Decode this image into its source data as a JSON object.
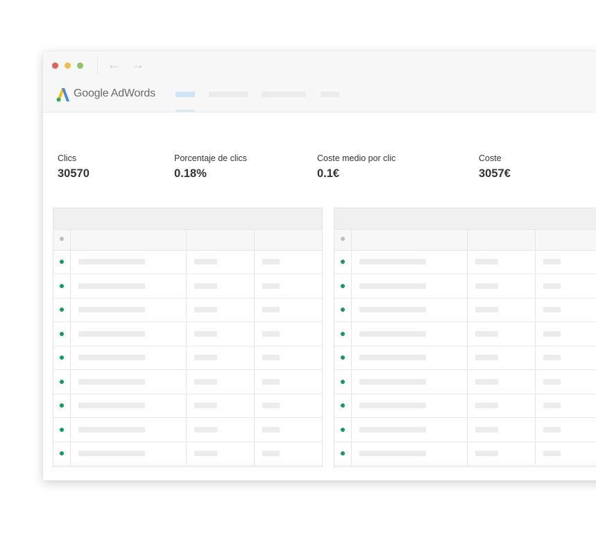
{
  "window": {
    "controls": {
      "close_color": "#e06257",
      "minimize_color": "#efbe4d",
      "maximize_color": "#8ec46b"
    },
    "nav": {
      "back_icon": "arrow-left-icon",
      "forward_icon": "arrow-right-icon"
    }
  },
  "app": {
    "logo_icon": "adwords-logo-icon",
    "brand_name": "Google AdWords",
    "tabs_count_visible": 4
  },
  "metrics": [
    {
      "label": "Clics",
      "value": "30570"
    },
    {
      "label": "Porcentaje de clics",
      "value": "0.18%"
    },
    {
      "label": "Coste medio por clic",
      "value": "0.1€"
    },
    {
      "label": "Coste",
      "value": "3057€"
    }
  ],
  "tables": {
    "row_status_color": "#0f9d58",
    "rows_per_table": 9
  }
}
